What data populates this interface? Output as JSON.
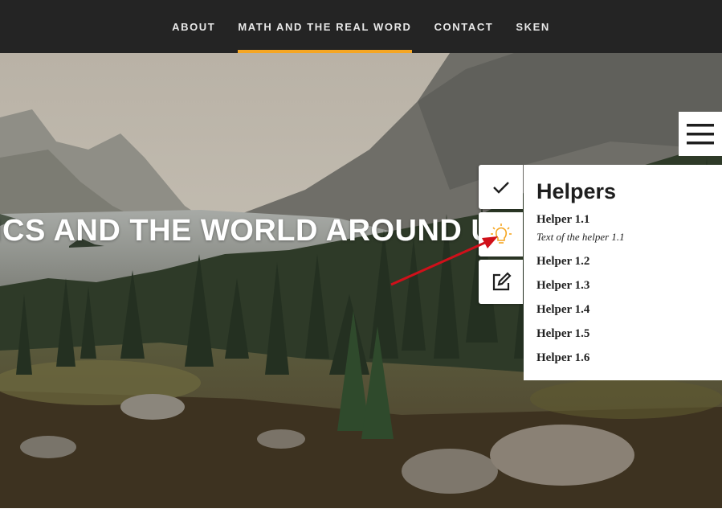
{
  "nav": {
    "items": [
      {
        "label": "ABOUT"
      },
      {
        "label": "MATH AND THE REAL WORD"
      },
      {
        "label": "CONTACT"
      },
      {
        "label": "SKEN"
      }
    ],
    "active_index": 1,
    "accent_color": "#f5a623"
  },
  "hero": {
    "title": "ICS AND THE WORLD AROUND U"
  },
  "menu_button": {
    "icon": "hamburger-icon"
  },
  "tools": [
    {
      "icon": "check-icon"
    },
    {
      "icon": "lightbulb-icon",
      "color": "#f5a623"
    },
    {
      "icon": "edit-icon"
    }
  ],
  "helpers": {
    "title": "Helpers",
    "items": [
      {
        "label": "Helper 1.1",
        "text": "Text of the helper 1.1"
      },
      {
        "label": "Helper 1.2"
      },
      {
        "label": "Helper 1.3"
      },
      {
        "label": "Helper 1.4"
      },
      {
        "label": "Helper 1.5"
      },
      {
        "label": "Helper 1.6"
      }
    ]
  },
  "annotation": {
    "arrow_color": "#d0101a"
  }
}
